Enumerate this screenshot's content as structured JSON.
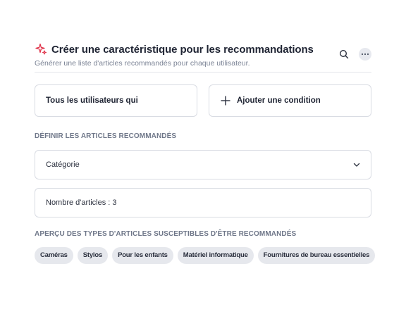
{
  "header": {
    "title": "Créer une caractéristique pour les recommandations",
    "subtitle": "Générer une liste d'articles recommandés pour chaque utilisateur.",
    "icons": {
      "title_icon": "sparkle-icon",
      "search": "search-icon",
      "more": "more-horizontal-icon"
    },
    "accent_color": "#e0334a"
  },
  "conditions": {
    "users_label": "Tous les utilisateurs qui",
    "add_condition_label": "Ajouter une condition"
  },
  "define": {
    "section_label": "DÉFINIR LES ARTICLES RECOMMANDÉS",
    "select_value": "Catégorie",
    "count_value": "Nombre d'articles : 3"
  },
  "preview": {
    "section_label": "APERÇU DES TYPES D'ARTICLES SUSCEPTIBLES D'ÊTRE RECOMMANDÉS",
    "chips": [
      "Caméras",
      "Stylos",
      "Pour les enfants",
      "Matériel informatique",
      "Fournitures de bureau essentielles"
    ]
  }
}
